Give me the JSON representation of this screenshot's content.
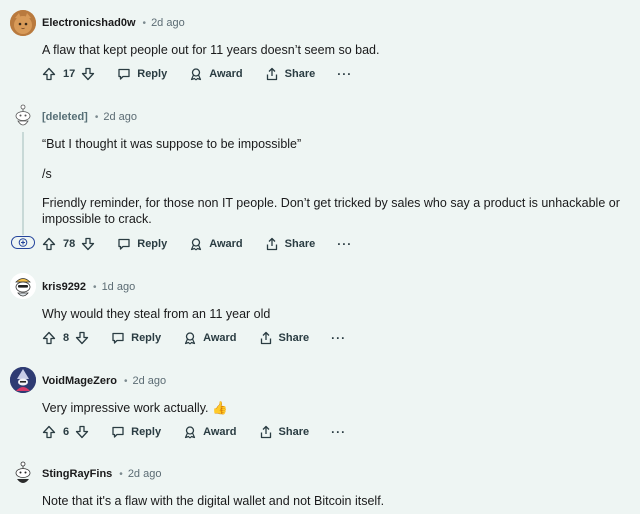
{
  "comments": [
    {
      "author": "Electronicshad0w",
      "time": "2d ago",
      "body": [
        "A flaw that kept people out for 11 years doesn’t seem so bad."
      ],
      "score": "17",
      "reply_label": "Reply",
      "award_label": "Award",
      "share_label": "Share",
      "more_label": "···"
    },
    {
      "author": "[deleted]",
      "time": "2d ago",
      "body": [
        "“But I thought it was suppose to be impossible”",
        "/s",
        "Friendly reminder, for those non IT people. Don’t get tricked by sales who say a product is unhackable or impossible to crack."
      ],
      "score": "78",
      "reply_label": "Reply",
      "award_label": "Award",
      "share_label": "Share",
      "more_label": "···"
    },
    {
      "author": "kris9292",
      "time": "1d ago",
      "body": [
        "Why would they steal from an 11 year old"
      ],
      "score": "8",
      "reply_label": "Reply",
      "award_label": "Award",
      "share_label": "Share",
      "more_label": "···"
    },
    {
      "author": "VoidMageZero",
      "time": "2d ago",
      "body": [
        "Very impressive work actually. 👍"
      ],
      "score": "6",
      "reply_label": "Reply",
      "award_label": "Award",
      "share_label": "Share",
      "more_label": "···"
    },
    {
      "author": "StingRayFins",
      "time": "2d ago",
      "body": [
        "Note that it's a flaw with the digital wallet and not Bitcoin itself."
      ]
    }
  ],
  "colors": {
    "background": "#eef5f3",
    "expand_button": "#24449c",
    "thread_line": "#c8d9d7"
  },
  "icons": [
    "upvote-icon",
    "downvote-icon",
    "reply-icon",
    "award-icon",
    "share-icon",
    "plus-circle-icon"
  ]
}
